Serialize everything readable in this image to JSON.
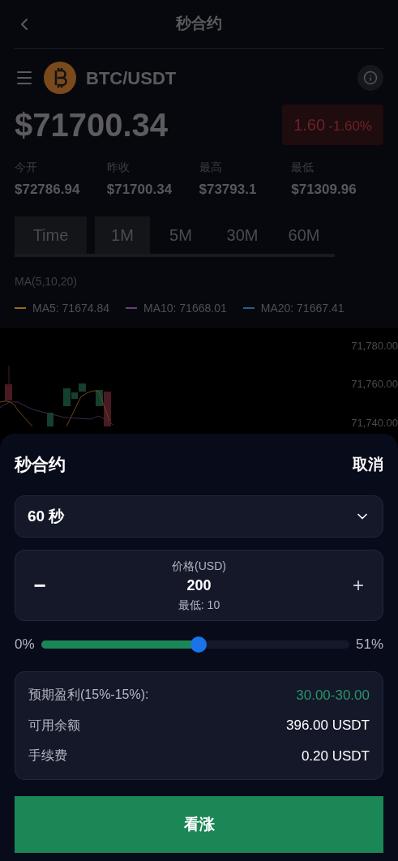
{
  "header": {
    "title": "秒合约"
  },
  "pair": {
    "symbol": "BTC/USDT",
    "price": "$71700.34",
    "change": "1.60",
    "change_pct": "-1.60%"
  },
  "stats": [
    {
      "label": "今开",
      "value": "$72786.94"
    },
    {
      "label": "昨收",
      "value": "$71700.34"
    },
    {
      "label": "最高",
      "value": "$73793.1"
    },
    {
      "label": "最低",
      "value": "$71309.96"
    }
  ],
  "intervals": [
    {
      "label": "Time",
      "selected": true
    },
    {
      "label": "1M",
      "selected": true
    },
    {
      "label": "5M",
      "selected": false
    },
    {
      "label": "30M",
      "selected": false
    },
    {
      "label": "60M",
      "selected": false
    }
  ],
  "ma": {
    "title": "MA(5,10,20)",
    "lines": [
      {
        "label": "MA5: 71674.84",
        "color": "#a0661c"
      },
      {
        "label": "MA10: 71668.01",
        "color": "#6b3f7a"
      },
      {
        "label": "MA20: 71667.41",
        "color": "#2a5d8a"
      }
    ]
  },
  "chart": {
    "y_labels": [
      "71,780.00",
      "71,760.00",
      "71,740.00"
    ]
  },
  "sheet": {
    "title": "秒合约",
    "cancel": "取消",
    "duration": "60 秒",
    "amount": {
      "label": "价格(USD)",
      "value": "200",
      "minimum": "最低: 10",
      "minus": "−",
      "plus": "+"
    },
    "slider": {
      "min_label": "0%",
      "max_label": "51%",
      "level": 0.51
    },
    "summary": [
      {
        "label": "预期盈利(15%-15%):",
        "value": "30.00-30.00",
        "kind": "profit"
      },
      {
        "label": "可用余额",
        "value": "396.00 USDT",
        "kind": "plain"
      },
      {
        "label": "手续费",
        "value": "0.20 USDT",
        "kind": "plain"
      }
    ],
    "submit": "看涨"
  }
}
